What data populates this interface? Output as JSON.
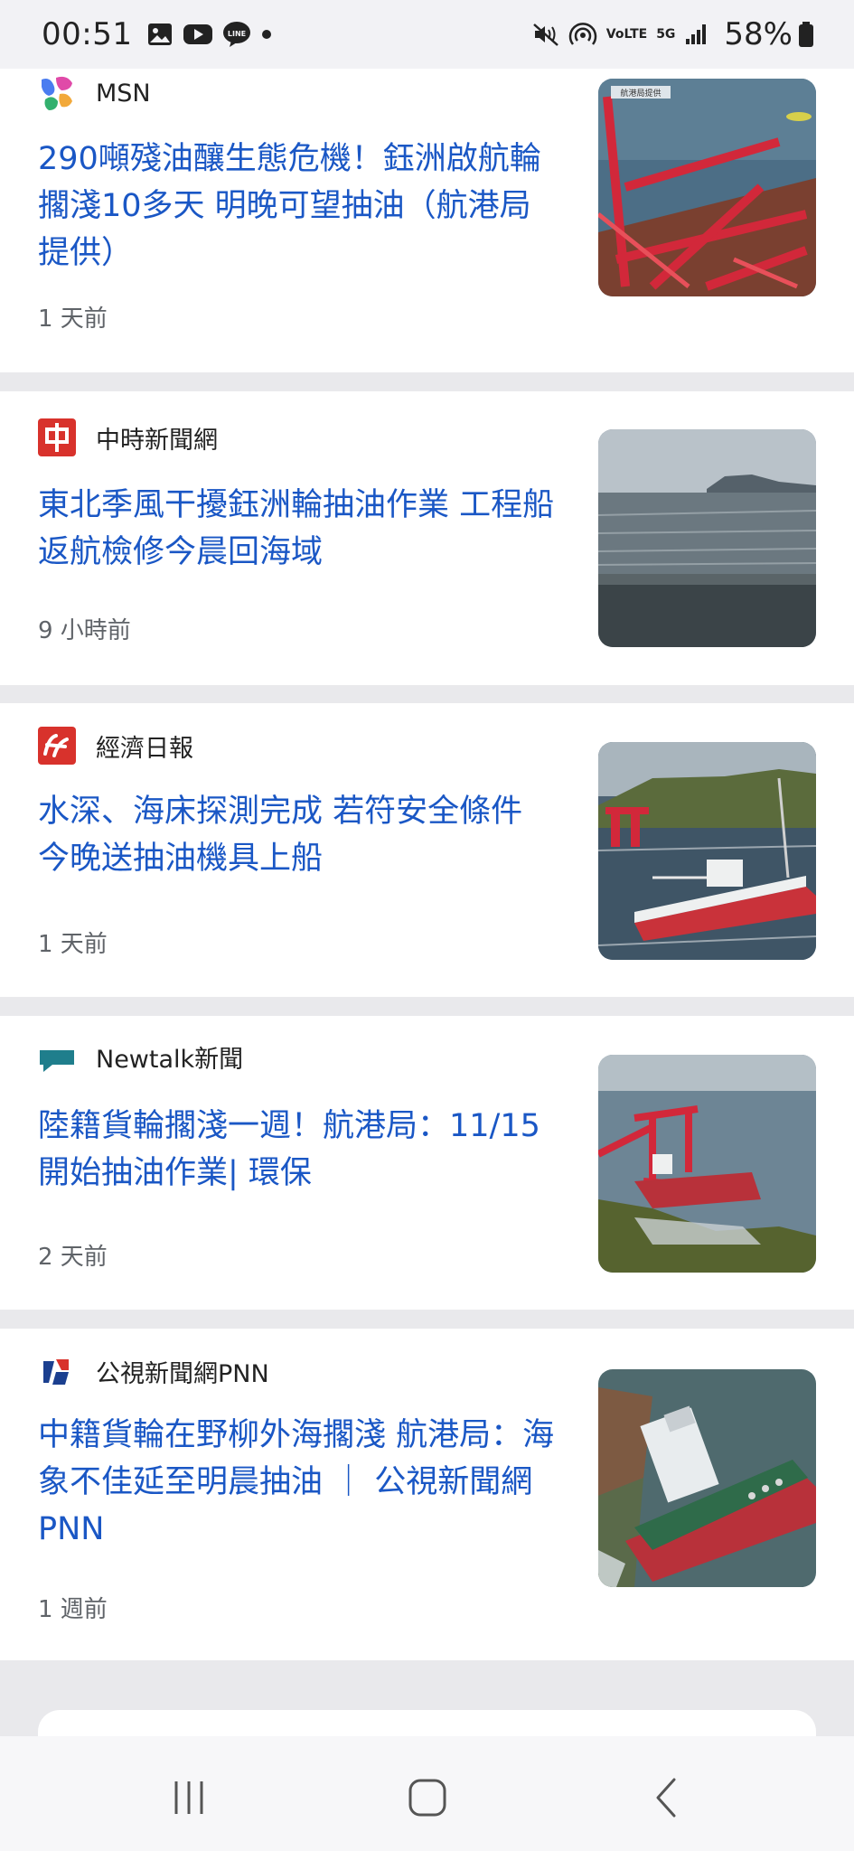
{
  "status_bar": {
    "time": "00:51",
    "battery_percent": "58%",
    "volte_label": "VoLTE",
    "network_label": "5G",
    "left_icons": [
      "gallery-icon",
      "youtube-icon",
      "line-icon",
      "notification-dot-icon"
    ],
    "right_icons": [
      "mute-vibrate-icon",
      "hotspot-icon",
      "volte-icon",
      "5g-icon",
      "signal-icon",
      "battery-icon"
    ]
  },
  "articles": [
    {
      "source": "MSN",
      "source_icon": "msn-logo-icon",
      "title": "290噸殘油釀生態危機！鈺洲啟航輪擱淺10多天 明晚可望抽油（航港局提供）",
      "time": "1 天前",
      "thumb_caption": "航港局提供",
      "thumb_subject": "red cargo crane wreck on ship deck"
    },
    {
      "source": "中時新聞網",
      "source_icon": "chinatimes-logo-icon",
      "title": "東北季風干擾鈺洲輪抽油作業 工程船返航檢修今晨回海域",
      "time": "9 小時前",
      "thumb_subject": "rough grey sea with island on horizon"
    },
    {
      "source": "經濟日報",
      "source_icon": "udn-money-logo-icon",
      "title": "水深、海床探測完成 若符安全條件 今晚送抽油機具上船",
      "time": "1 天前",
      "thumb_subject": "engineering ship near stranded vessel by coast"
    },
    {
      "source": "Newtalk新聞",
      "source_icon": "newtalk-logo-icon",
      "title": "陸籍貨輪擱淺一週！航港局：11/15開始抽油作業| 環保",
      "time": "2 天前",
      "thumb_subject": "stranded red crane ship on rocky shore"
    },
    {
      "source": "公視新聞網PNN",
      "source_icon": "pts-logo-icon",
      "title": "中籍貨輪在野柳外海擱淺 航港局：海象不佳延至明晨抽油 ｜ 公視新聞網 PNN",
      "time": "1 週前",
      "thumb_subject": "aerial view of stranded red and green ship"
    }
  ],
  "nav_bar": {
    "buttons": [
      "recent-apps-button",
      "home-button",
      "back-button"
    ]
  }
}
